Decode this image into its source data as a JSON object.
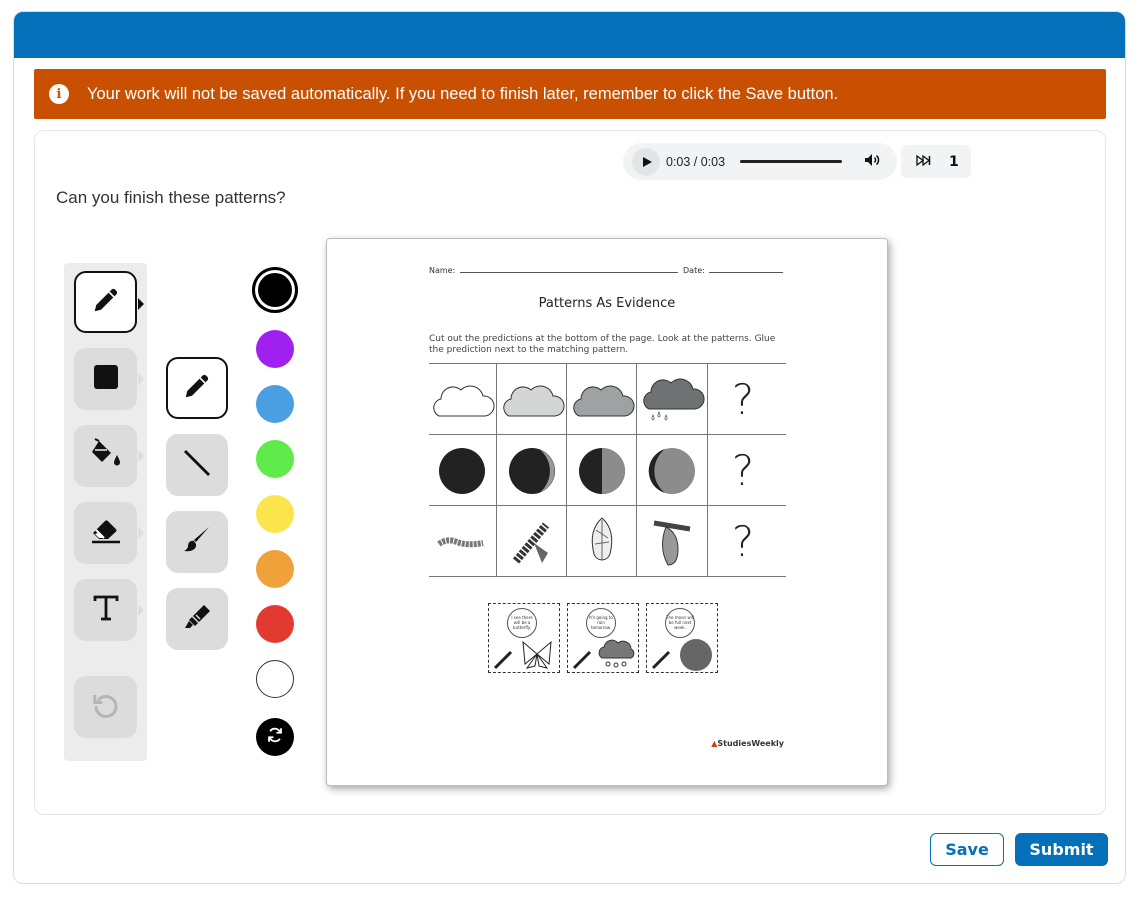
{
  "banner": {
    "text": "Your work will not be saved automatically. If you need to finish later, remember to click the Save button.",
    "icon": "info-icon"
  },
  "audio": {
    "time": "0:03 / 0:03",
    "progress": 1.0,
    "speed": "1"
  },
  "question": {
    "text": "Can you finish these patterns?"
  },
  "tools": [
    {
      "name": "pencil",
      "icon": "pencil-icon",
      "selected": true
    },
    {
      "name": "shape",
      "icon": "square-icon",
      "selected": false
    },
    {
      "name": "fill",
      "icon": "paint-bucket-icon",
      "selected": false
    },
    {
      "name": "eraser",
      "icon": "eraser-icon",
      "selected": false
    },
    {
      "name": "text",
      "icon": "text-icon",
      "selected": false
    },
    {
      "name": "undo",
      "icon": "undo-icon",
      "selected": false
    }
  ],
  "subtools": [
    {
      "name": "pencil",
      "icon": "pencil-icon",
      "selected": true
    },
    {
      "name": "line",
      "icon": "line-icon",
      "selected": false
    },
    {
      "name": "brush",
      "icon": "brush-icon",
      "selected": false
    },
    {
      "name": "highlighter",
      "icon": "highlighter-icon",
      "selected": false
    }
  ],
  "colors": [
    "#000000",
    "#a020f0",
    "#4a9fe3",
    "#5fec4a",
    "#fbe54c",
    "#f0a23a",
    "#e33a30",
    "#ffffff"
  ],
  "worksheet": {
    "name_label": "Name:",
    "date_label": "Date:",
    "title": "Patterns As Evidence",
    "instructions": "Cut out the predictions at the bottom of the page. Look at the patterns. Glue the prediction next to the matching pattern.",
    "question_mark": "?",
    "cutouts": [
      "I see there will be a butterfly.",
      "It's going to rain tomorrow.",
      "The moon will be full next week."
    ],
    "logo": "StudiesWeekly"
  },
  "buttons": {
    "save": "Save",
    "submit": "Submit"
  }
}
